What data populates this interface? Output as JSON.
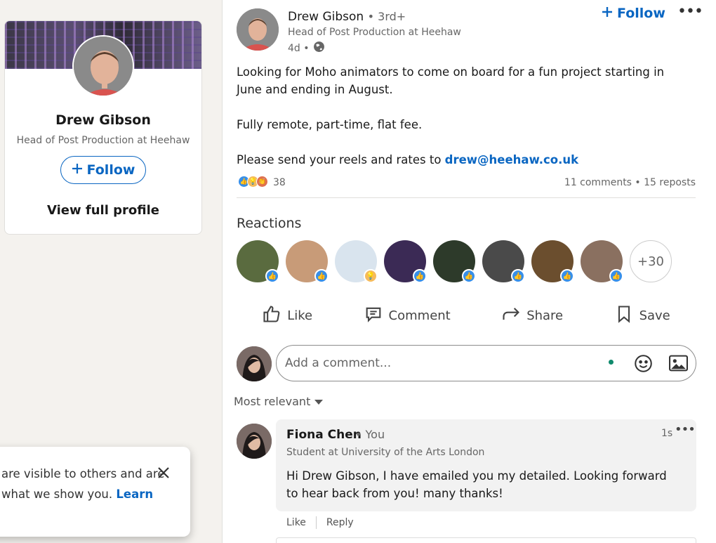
{
  "profile_card": {
    "name": "Drew Gibson",
    "headline": "Head of Post Production at Heehaw",
    "follow_label": "Follow",
    "view_profile_label": "View full profile"
  },
  "toast": {
    "line1": "are visible to others and are",
    "line2": "what we show you.",
    "learn_label": "Learn"
  },
  "post": {
    "author": "Drew Gibson",
    "degree": "• 3rd+",
    "headline": "Head of Post Production at Heehaw",
    "age": "4d •",
    "follow_label": "Follow",
    "body_line1": "Looking for Moho animators to come on board for a fun project starting in June and ending in August.",
    "body_line2": "Fully remote, part-time, flat fee.",
    "body_line3_prefix": "Please send your reels and rates to ",
    "email": "drew@heehaw.co.uk",
    "reaction_count": "38",
    "comments_reposts": "11 comments • 15 reposts"
  },
  "reactions": {
    "title": "Reactions",
    "more_label": "+30"
  },
  "actions": {
    "like": "Like",
    "comment": "Comment",
    "share": "Share",
    "save": "Save"
  },
  "comment_input": {
    "placeholder": "Add a comment..."
  },
  "sort": {
    "label": "Most relevant"
  },
  "comment": {
    "name": "Fiona Chen",
    "you": "• You",
    "time": "1s",
    "headline": "Student at University of the Arts London",
    "text": "Hi Drew Gibson, I have emailed you my detailed. Looking forward to hear back from you! many thanks!",
    "like_label": "Like",
    "reply_label": "Reply"
  },
  "colors": {
    "accent": "#0a66c2",
    "like_blue": "#378fe9",
    "idea_yellow": "#f5bb5c",
    "background": "#f4f2ee"
  }
}
